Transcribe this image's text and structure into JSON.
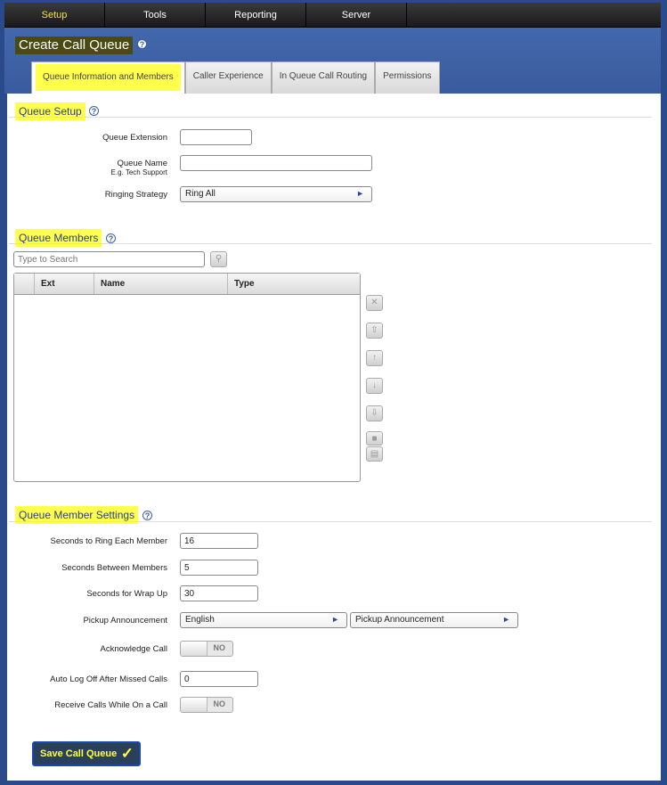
{
  "nav": {
    "items": [
      "Setup",
      "Tools",
      "Reporting",
      "Server"
    ]
  },
  "page": {
    "title": "Create Call Queue"
  },
  "tabs": [
    "Queue Information and Members",
    "Caller Experience",
    "In Queue Call Routing",
    "Permissions"
  ],
  "queue_setup": {
    "title": "Queue Setup",
    "extension_label": "Queue Extension",
    "extension_value": "",
    "name_label": "Queue Name",
    "name_hint": "E.g. Tech Support",
    "name_value": "",
    "strategy_label": "Ringing Strategy",
    "strategy_value": "Ring All"
  },
  "members": {
    "title": "Queue Members",
    "search_placeholder": "Type to Search",
    "columns": [
      "Ext",
      "Name",
      "Type"
    ]
  },
  "member_settings": {
    "title": "Queue Member Settings",
    "ring_label": "Seconds to Ring Each Member",
    "ring_value": "16",
    "between_label": "Seconds Between Members",
    "between_value": "5",
    "wrap_label": "Seconds for Wrap Up",
    "wrap_value": "30",
    "pickup_label": "Pickup Announcement",
    "pickup_language": "English",
    "pickup_value": "Pickup Announcement",
    "ack_label": "Acknowledge Call",
    "ack_state": "NO",
    "logoff_label": "Auto Log Off After Missed Calls",
    "logoff_value": "0",
    "receive_label": "Receive Calls While On a Call",
    "receive_state": "NO"
  },
  "save_label": "Save Call Queue"
}
